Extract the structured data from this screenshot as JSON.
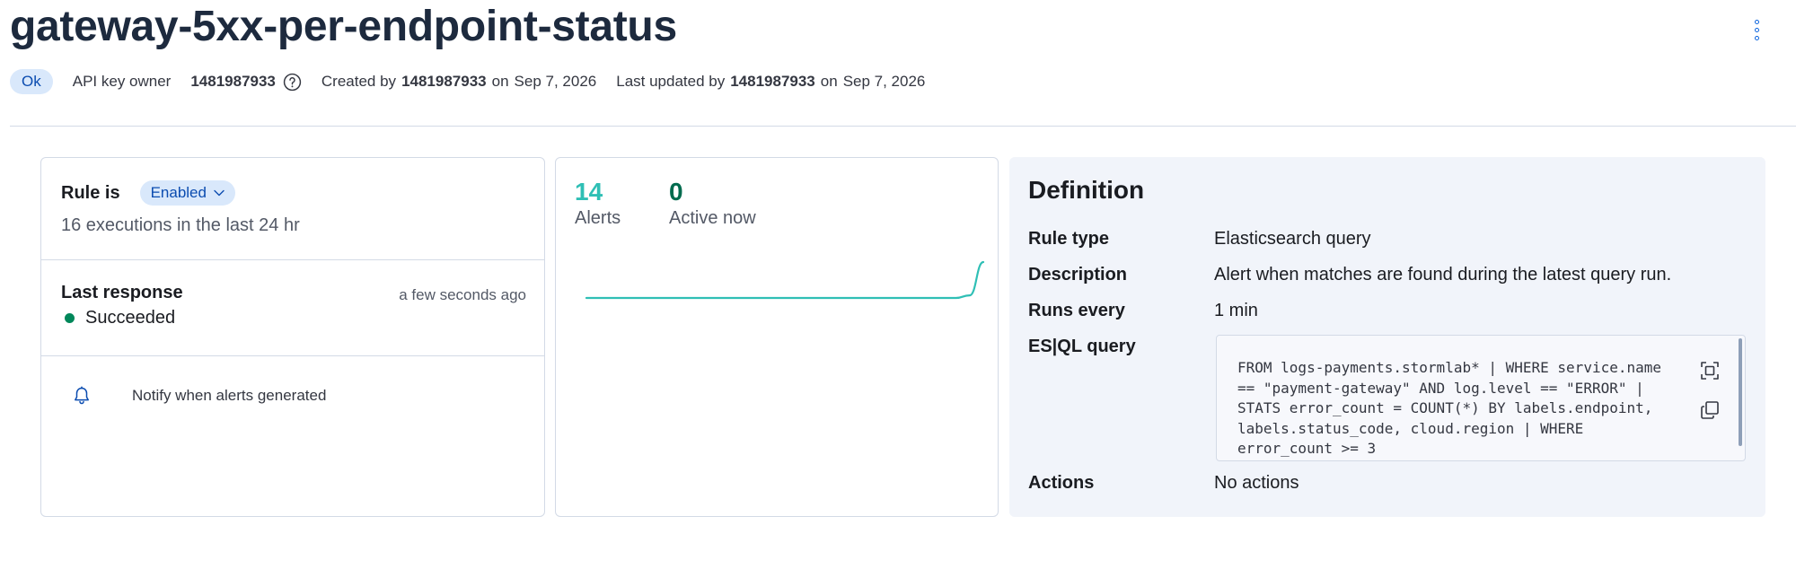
{
  "header": {
    "title": "gateway-5xx-per-endpoint-status",
    "status": "Ok",
    "api_key_owner_label": "API key owner",
    "api_key_owner": "1481987933",
    "created_label": "Created by",
    "created_by": "1481987933",
    "created_on_label": "on",
    "created_date": "Sep 7, 2026",
    "updated_label": "Last updated by",
    "updated_by": "1481987933",
    "updated_on_label": "on",
    "updated_date": "Sep 7, 2026"
  },
  "rule_panel": {
    "rule_is_label": "Rule is",
    "state": "Enabled",
    "executions": "16 executions in the last 24 hr",
    "last_response_label": "Last response",
    "last_response_time": "a few seconds ago",
    "last_response_status": "Succeeded",
    "notify_text": "Notify when alerts generated",
    "status_color": "#00875a"
  },
  "alerts_panel": {
    "total_value": "14",
    "total_label": "Alerts",
    "active_value": "0",
    "active_label": "Active now",
    "sparkline": [
      0,
      0,
      0,
      0,
      0,
      0,
      0,
      0,
      0,
      0,
      0,
      0,
      0,
      0,
      0,
      0,
      0,
      0,
      0,
      0,
      0,
      0,
      0,
      0,
      0,
      0,
      0,
      0,
      1,
      14
    ],
    "accent_color": "#2fbfb5"
  },
  "definition": {
    "title": "Definition",
    "rows": [
      {
        "key": "Rule type",
        "value": "Elasticsearch query"
      },
      {
        "key": "Description",
        "value": "Alert when matches are found during the latest query run."
      },
      {
        "key": "Runs every",
        "value": "1 min"
      },
      {
        "key": "ES|QL query",
        "value": ""
      },
      {
        "key": "Actions",
        "value": "No actions"
      }
    ],
    "query": "FROM logs-payments.stormlab* | WHERE service.name == \"payment-gateway\" AND log.level == \"ERROR\" | STATS error_count = COUNT(*) BY labels.endpoint, labels.status_code, cloud.region | WHERE error_count >= 3"
  },
  "icons": {
    "menu": "kebab-menu-icon",
    "help": "question-circle-icon",
    "chevron": "chevron-down-icon",
    "bell": "bell-icon",
    "fullscreen": "fullscreen-icon",
    "copy": "copy-icon"
  }
}
